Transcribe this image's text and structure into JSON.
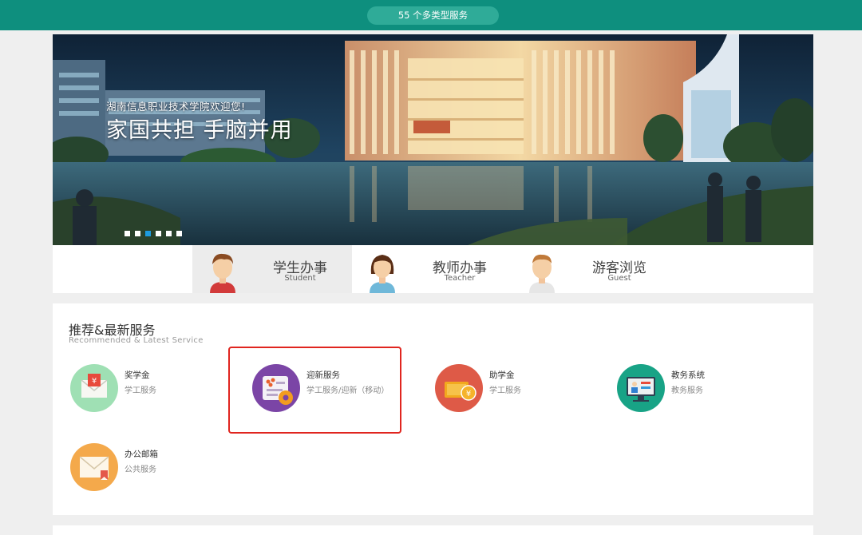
{
  "topbar": {
    "service_count_label": "55 个多类型服务",
    "color": "#0e8f7e"
  },
  "banner": {
    "subtitle": "湖南信息职业技术学院欢迎您!",
    "title": "家国共担 手脑并用",
    "slide_count": 6,
    "active_slide": 3
  },
  "roles": [
    {
      "name": "学生办事",
      "en": "Student",
      "active": true
    },
    {
      "name": "教师办事",
      "en": "Teacher",
      "active": false
    },
    {
      "name": "游客浏览",
      "en": "Guest",
      "active": false
    }
  ],
  "recommended": {
    "title": "推荐&最新服务",
    "subtitle": "Recommended & Latest Service",
    "services": [
      {
        "name": "奖学金",
        "category": "学工服务",
        "icon": "scholarship-envelope-icon",
        "color": "#9fe0b4"
      },
      {
        "name": "迎新服务",
        "category": "学工服务/迎新（移动）",
        "icon": "welcome-service-icon",
        "color": "#7b45a6"
      },
      {
        "name": "助学金",
        "category": "学工服务",
        "icon": "grant-coin-icon",
        "color": "#de5a47"
      },
      {
        "name": "教务系统",
        "category": "教务服务",
        "icon": "academic-system-icon",
        "color": "#18a386"
      },
      {
        "name": "办公邮箱",
        "category": "公共服务",
        "icon": "office-mail-icon",
        "color": "#f4a94b"
      }
    ]
  }
}
